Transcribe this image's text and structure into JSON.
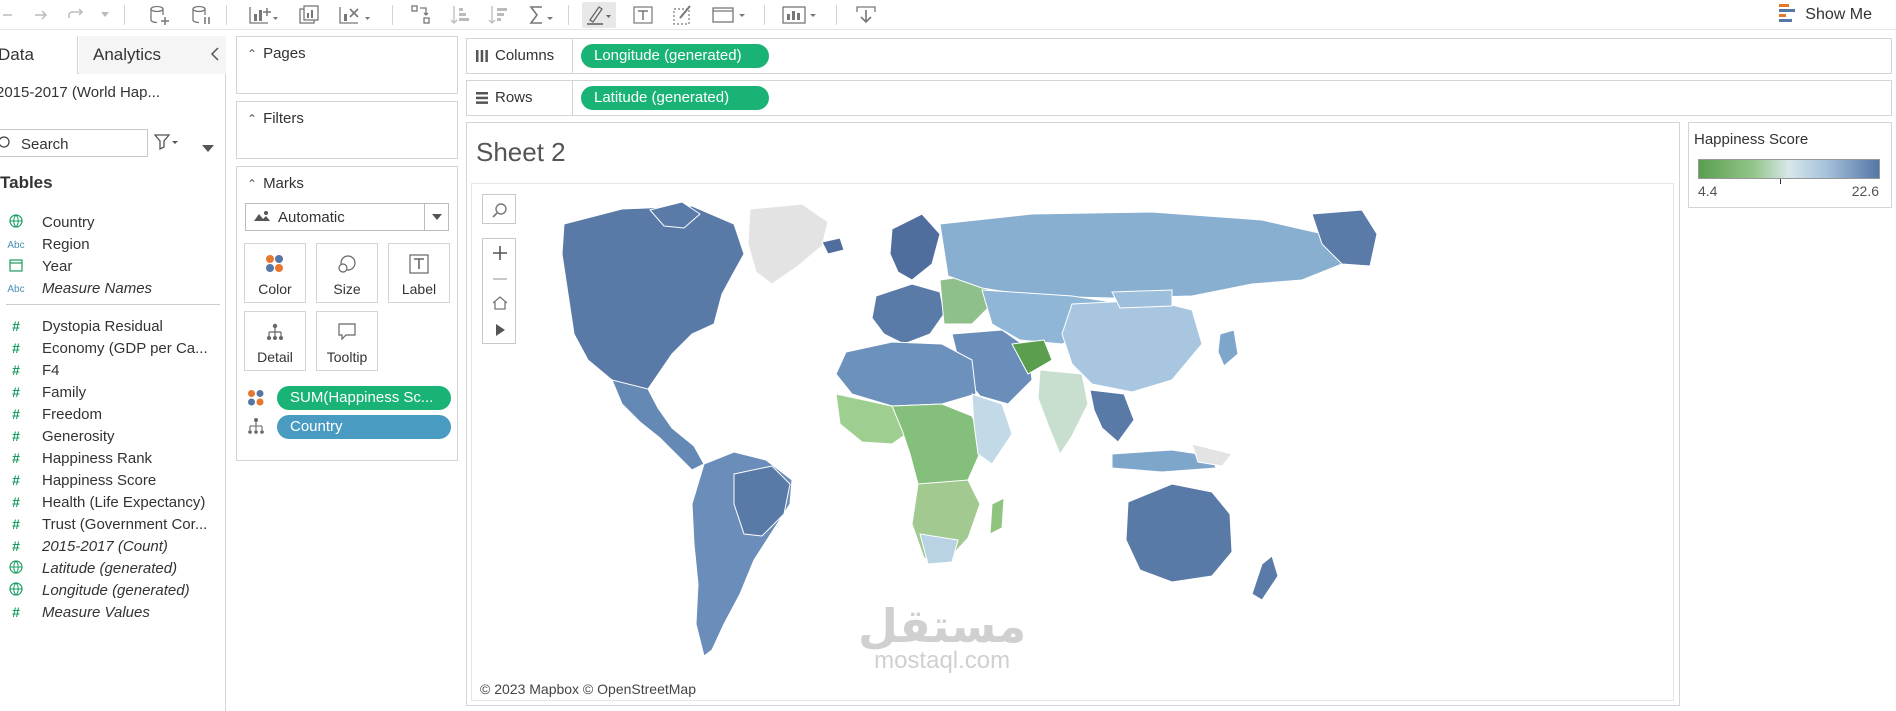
{
  "toolbar": {
    "show_me_label": "Show Me"
  },
  "data_pane": {
    "tabs": [
      "Data",
      "Analytics"
    ],
    "datasource": "2015-2017 (World Hap...",
    "search_placeholder": "Search",
    "tables_heading": "Tables",
    "dimensions": [
      {
        "name": "Country",
        "icon": "globe-icon"
      },
      {
        "name": "Region",
        "icon": "abc-icon"
      },
      {
        "name": "Year",
        "icon": "calendar-icon"
      },
      {
        "name": "Measure Names",
        "icon": "abc-icon"
      }
    ],
    "measures": [
      {
        "name": "Dystopia Residual",
        "icon": "hash-icon"
      },
      {
        "name": "Economy (GDP per Ca...",
        "icon": "hash-icon"
      },
      {
        "name": "F4",
        "icon": "hash-icon"
      },
      {
        "name": "Family",
        "icon": "hash-icon"
      },
      {
        "name": "Freedom",
        "icon": "hash-icon"
      },
      {
        "name": "Generosity",
        "icon": "hash-icon"
      },
      {
        "name": "Happiness Rank",
        "icon": "hash-icon"
      },
      {
        "name": "Happiness Score",
        "icon": "hash-icon"
      },
      {
        "name": "Health (Life Expectancy)",
        "icon": "hash-icon"
      },
      {
        "name": "Trust (Government Cor...",
        "icon": "hash-icon"
      },
      {
        "name": "2015-2017 (Count)",
        "icon": "hash-icon"
      },
      {
        "name": "Latitude (generated)",
        "icon": "globe-icon"
      },
      {
        "name": "Longitude (generated)",
        "icon": "globe-icon"
      },
      {
        "name": "Measure Values",
        "icon": "hash-icon"
      }
    ]
  },
  "cards": {
    "pages": "Pages",
    "filters": "Filters",
    "marks": "Marks",
    "mark_type": "Automatic",
    "mark_buttons": [
      "Color",
      "Size",
      "Label",
      "Detail",
      "Tooltip"
    ],
    "mark_pills": [
      "SUM(Happiness Sc...",
      "Country"
    ]
  },
  "shelves": {
    "columns_label": "Columns",
    "columns_pill": "Longitude (generated)",
    "rows_label": "Rows",
    "rows_pill": "Latitude (generated)"
  },
  "view": {
    "sheet_title": "Sheet 2",
    "attribution": "© 2023 Mapbox  © OpenStreetMap",
    "watermark_arabic": "مستقل",
    "watermark_latin": "mostaql.com"
  },
  "legend": {
    "title": "Happiness Score",
    "min": "4.4",
    "max": "22.6",
    "colors": {
      "low": "#5a9e4e",
      "mid": "#d7e7ea",
      "high": "#5477a6"
    }
  },
  "colors": {
    "pill_green": "#19b376",
    "pill_blue": "#4a9bc1",
    "accent": "#e8762d"
  }
}
